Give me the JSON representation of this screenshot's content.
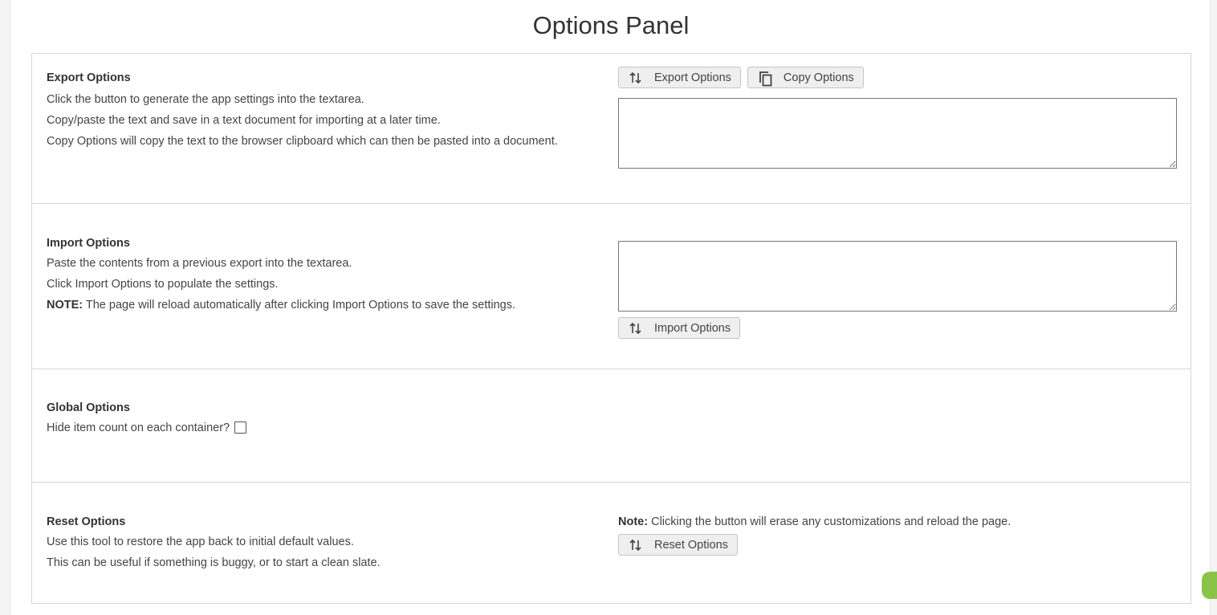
{
  "page": {
    "title": "Options Panel"
  },
  "export": {
    "heading": "Export Options",
    "lines": [
      "Click the button to generate the app settings into the textarea.",
      "Copy/paste the text and save in a text document for importing at a later time.",
      "Copy Options will copy the text to the browser clipboard which can then be pasted into a document."
    ],
    "export_button_label": "Export Options",
    "copy_button_label": "Copy Options",
    "textarea_value": ""
  },
  "import": {
    "heading": "Import Options",
    "lines": [
      "Paste the contents from a previous export into the textarea.",
      "Click Import Options to populate the settings."
    ],
    "note_label": "NOTE:",
    "note_text": " The page will reload automatically after clicking Import Options to save the settings.",
    "textarea_value": "",
    "import_button_label": "Import Options"
  },
  "global": {
    "heading": "Global Options",
    "hide_count_label": "Hide item count on each container?",
    "hide_count_checked": false
  },
  "reset": {
    "heading": "Reset Options",
    "lines": [
      "Use this tool to restore the app back to initial default values.",
      "This can be useful if something is buggy, or to start a clean slate."
    ],
    "note_label": "Note:",
    "note_text": " Clicking the button will erase any customizations and reload the page.",
    "reset_button_label": "Reset Options"
  },
  "icons": {
    "export": "swap-vertical-icon",
    "copy": "copy-icon",
    "import": "swap-vertical-icon",
    "reset": "swap-vertical-icon"
  },
  "colors": {
    "accent_badge": "#8bc34a"
  }
}
